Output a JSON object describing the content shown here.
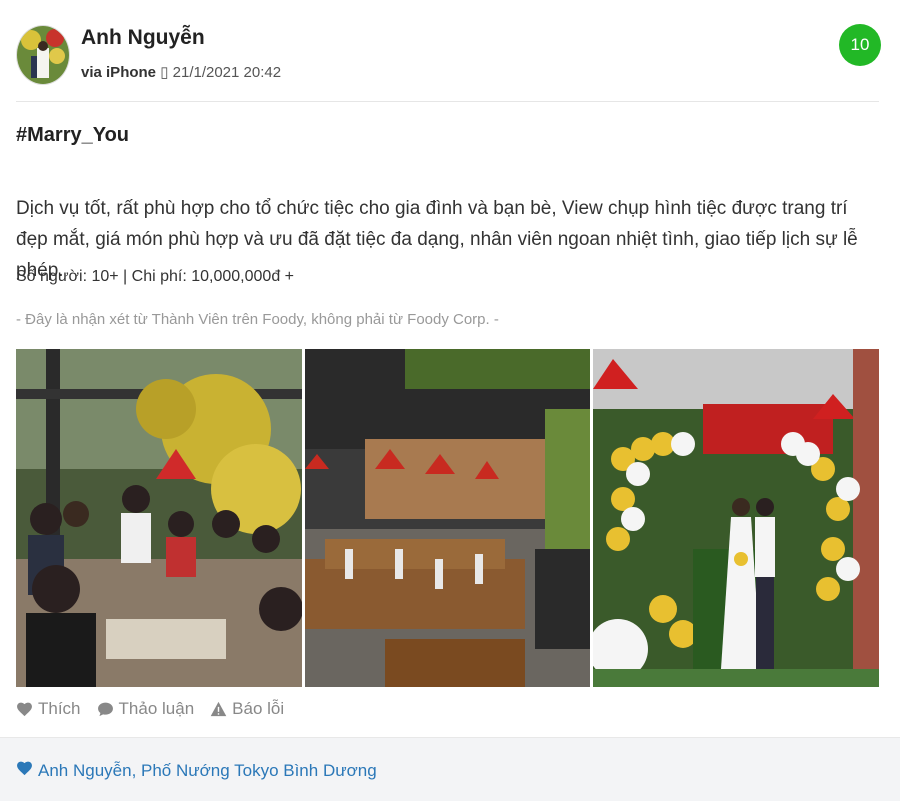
{
  "review": {
    "author_name": "Anh Nguyễn",
    "via": "via iPhone",
    "timestamp": "21/1/2021 20:42",
    "score": "10",
    "title": "#Marry_You",
    "body": "Dịch vụ tốt, rất phù hợp cho tổ chức tiệc cho gia đình và bạn bè, View chụp hình tiệc được trang trí đẹp mắt, giá món phù hợp và ưu đã đặt tiệc đa dạng, nhân viên ngoan nhiệt tình, giao tiếp lịch sự lễ phép.",
    "info": "Số người: 10+ | Chi phí: 10,000,000đ +",
    "disclaimer": "- Đây là nhận xét từ Thành Viên trên Foody, không phải từ Foody Corp. -"
  },
  "actions": {
    "like": "Thích",
    "discuss": "Thảo luận",
    "report": "Báo lỗi"
  },
  "footer": {
    "likers": "Anh Nguyễn, Phố Nướng Tokyo Bình Dương"
  },
  "colors": {
    "score_bg": "#22b826",
    "link": "#2b78b8"
  },
  "icons": [
    "heart-icon",
    "comment-icon",
    "warning-icon"
  ]
}
